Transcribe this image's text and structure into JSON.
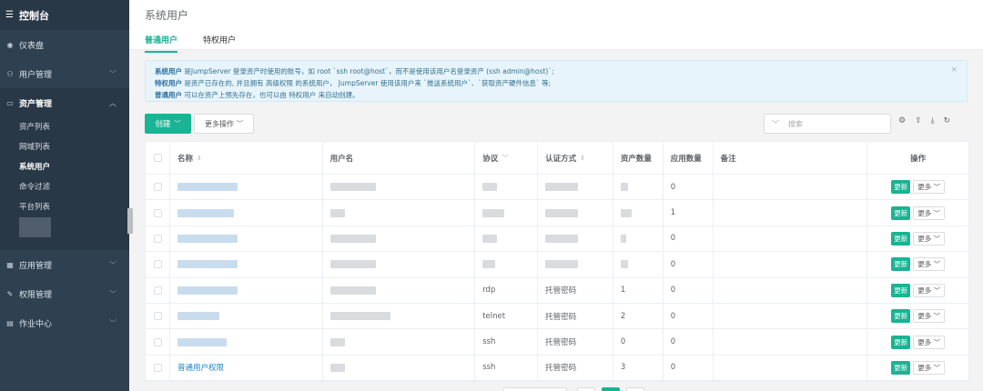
{
  "sidebar": {
    "title": "控制台",
    "items": [
      {
        "label": "仪表盘"
      },
      {
        "label": "用户管理"
      },
      {
        "label": "资产管理"
      },
      {
        "label": "应用管理"
      },
      {
        "label": "权限管理"
      },
      {
        "label": "作业中心"
      }
    ],
    "sub_items": [
      "资产列表",
      "网域列表",
      "系统用户",
      "命令过滤",
      "平台列表"
    ],
    "active_sub": "系统用户"
  },
  "header": {
    "title": "系统用户",
    "tabs": [
      "普通用户",
      "特权用户"
    ]
  },
  "alert": {
    "line1_bold": "系统用户",
    "line1": " 是JumpServer 登录资产时使用的账号，如 root `ssh root@host`，而不是使用该用户名登录资产 (ssh admin@host)`;",
    "line2_bold": "特权用户",
    "line2": " 是资产已存在的, 并且拥有 高级权限 的系统用户， JumpServer 使用该用户来 `推送系统用户`、`获取资产硬件信息` 等;",
    "line3_bold": "普通用户",
    "line3": " 可以在资产上预先存在，也可以由 特权用户 来自动创建。",
    "close": "×"
  },
  "toolbar": {
    "create_label": "创建",
    "more_label": "更多操作",
    "search_placeholder": "搜索"
  },
  "table": {
    "columns": [
      "名称",
      "用户名",
      "协议",
      "认证方式",
      "资产数量",
      "应用数量",
      "备注",
      "操作"
    ],
    "rows": [
      {
        "name": "",
        "protocol": "",
        "auth": "",
        "assets": "",
        "apps": "0"
      },
      {
        "name": "",
        "protocol": "",
        "auth": "",
        "assets": "",
        "apps": "1"
      },
      {
        "name": "",
        "protocol": "",
        "auth": "",
        "assets": "",
        "apps": "0"
      },
      {
        "name": "",
        "protocol": "",
        "auth": "",
        "assets": "",
        "apps": "0"
      },
      {
        "name": "",
        "protocol": "rdp",
        "auth": "托管密码",
        "assets": "1",
        "apps": "0"
      },
      {
        "name": "",
        "protocol": "telnet",
        "auth": "托管密码",
        "assets": "2",
        "apps": "0"
      },
      {
        "name": "",
        "protocol": "ssh",
        "auth": "托管密码",
        "assets": "0",
        "apps": "0"
      },
      {
        "name": "普通用户权限",
        "protocol": "ssh",
        "auth": "托管密码",
        "assets": "3",
        "apps": "0"
      }
    ],
    "update_label": "更新",
    "more_label": "更多"
  }
}
